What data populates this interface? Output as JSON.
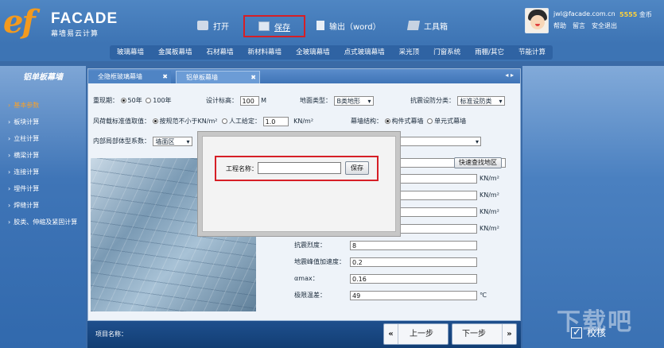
{
  "header": {
    "logo_ef": "ef",
    "logo_facade": "FACADE",
    "logo_sub": "幕墙易云计算",
    "nav": {
      "open": "打开",
      "save": "保存",
      "output": "输出（word）",
      "tools": "工具箱"
    },
    "user": {
      "email": "jwl@facade.com.cn",
      "coins_value": "5555",
      "coins_unit": "金币",
      "help": "帮助",
      "message": "留言",
      "logout": "安全退出"
    }
  },
  "tabbar": {
    "tabs": [
      "玻璃幕墙",
      "金属板幕墙",
      "石材幕墙",
      "新材料幕墙",
      "全玻璃幕墙",
      "点式玻璃幕墙",
      "采光顶",
      "门窗系统",
      "雨棚/其它",
      "节能计算"
    ]
  },
  "sidebar": {
    "title": "铝单板幕墙",
    "items": [
      "基本参数",
      "板块计算",
      "立柱计算",
      "横梁计算",
      "连接计算",
      "埋件计算",
      "焊缝计算",
      "胶类、伸缩及紧固计算"
    ]
  },
  "doctabs": {
    "tab1": "全隐框玻璃幕墙",
    "tab2": "铝单板幕墙",
    "close": "✖",
    "arrows": "◂ ▸"
  },
  "form": {
    "period_label": "重现期：",
    "period_50": "50年",
    "period_100": "100年",
    "design_height_label": "设计标高：",
    "design_height_value": "100",
    "design_height_unit": "M",
    "terrain_label": "地面类型：",
    "terrain_value": "B类地形",
    "seismic_label": "抗震设防分类：",
    "seismic_value": "标准设防类",
    "wind_label": "风荷载标准值取值：",
    "wind_opt1": "按规范不小于KN/m²",
    "wind_opt2": "人工给定：",
    "wind_value": "1.0",
    "wind_unit": "KN/m²",
    "structure_label": "幕墙结构：",
    "structure_opt1": "构件式幕墙",
    "structure_opt2": "单元式幕墙",
    "internal_label": "内部局部体型系数：",
    "internal_value": "墙面区",
    "find_region_button": "快速查找地区",
    "unit_kn": "KN/m²",
    "seismic_intensity_label": "抗震烈度：",
    "seismic_intensity_value": "8",
    "peak_accel_label": "地震峰值加速度：",
    "peak_accel_value": "0.2",
    "amax_label": "αmax：",
    "amax_value": "0.16",
    "temp_label": "极限温差：",
    "temp_value": "49",
    "temp_unit": "℃"
  },
  "modal": {
    "label": "工程名称：",
    "input_value": "",
    "save_button": "保存"
  },
  "bottom": {
    "project_label": "项目名称：",
    "prev": "上一步",
    "next": "下一步",
    "prev_arrow": "«",
    "next_arrow": "»",
    "verify": "校核"
  },
  "watermark": "下载吧"
}
